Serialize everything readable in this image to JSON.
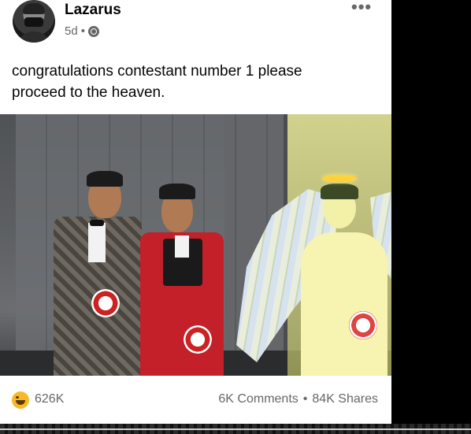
{
  "post": {
    "author": "Lazarus",
    "time": "5d",
    "separator": "•",
    "more_label": "•••",
    "caption_line1": "congratulations contestant number 1 please",
    "caption_line2": "proceed to the heaven."
  },
  "footer": {
    "reaction_count": "626K",
    "comments": "6K Comments",
    "separator": "•",
    "shares": "84K Shares"
  },
  "icons": {
    "privacy": "globe-icon",
    "reaction": "haha-reaction-icon",
    "more": "more-options-icon"
  },
  "colors": {
    "card_bg": "#ffffff",
    "text_primary": "#050505",
    "text_secondary": "#65676b",
    "reaction_yellow": "#f7b928",
    "halo_gold": "#ffd23a"
  }
}
